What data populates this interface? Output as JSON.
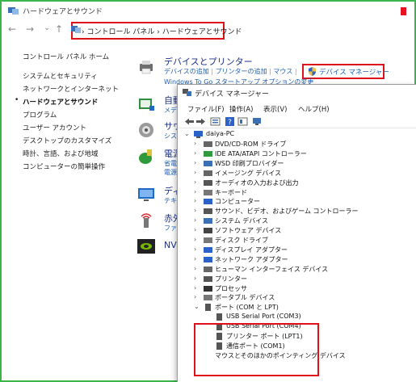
{
  "window": {
    "title": "ハードウェアとサウンド"
  },
  "breadcrumb": {
    "items": [
      "コントロール パネル",
      "ハードウェアとサウンド"
    ],
    "sep": "›"
  },
  "nav": {
    "back": "←",
    "forward": "→",
    "down": "⌄",
    "up": "↑"
  },
  "sidebar": {
    "home": "コントロール パネル ホーム",
    "items": [
      "システムとセキュリティ",
      "ネットワークとインターネット",
      "ハードウェアとサウンド",
      "プログラム",
      "ユーザー アカウント",
      "デスクトップのカスタマイズ",
      "時計、言語、および地域",
      "コンピューターの簡単操作"
    ],
    "bullet": "•"
  },
  "categories": {
    "devices": {
      "title": "デバイスとプリンター",
      "links": [
        "デバイスの追加",
        "プリンターの追加",
        "マウス",
        "デバイス マネージャー"
      ],
      "link2": "Windows To Go スタートアップ オプションの変更"
    },
    "autoplay": {
      "title": "自動",
      "link": "メディ"
    },
    "sound": {
      "title": "サウ",
      "link": "シス"
    },
    "power": {
      "title": "電源",
      "link": "省電",
      "link2": "電源"
    },
    "display": {
      "title": "ディス",
      "link": "テキ"
    },
    "infrared": {
      "title": "赤外",
      "link": "ファイ"
    },
    "nvidia": {
      "title": "NVI"
    }
  },
  "devmgr": {
    "title": "デバイス マネージャー",
    "menu": [
      "ファイル(F)",
      "操作(A)",
      "表示(V)",
      "ヘルプ(H)"
    ],
    "root": "daiya-PC",
    "nodes": [
      "DVD/CD-ROM ドライブ",
      "IDE ATA/ATAPI コントローラー",
      "WSD 印刷プロバイダー",
      "イメージング デバイス",
      "オーディオの入力および出力",
      "キーボード",
      "コンピューター",
      "サウンド、ビデオ、およびゲーム コントローラー",
      "システム デバイス",
      "ソフトウェア デバイス",
      "ディスク ドライブ",
      "ディスプレイ アダプター",
      "ネットワーク アダプター",
      "ヒューマン インターフェイス デバイス",
      "プリンター",
      "プロセッサ",
      "ポータブル デバイス"
    ],
    "ports_label": "ポート (COM と LPT)",
    "ports": [
      "USB Serial Port (COM3)",
      "USB Serial Port (COM4)",
      "プリンター ポート (LPT1)",
      "通信ポート (COM1)"
    ],
    "next_partial": "マウスとそのほかのポインティング デバイス",
    "expanded": "⌄",
    "collapsed": "›"
  },
  "colors": {
    "highlight": "#e0101a",
    "link": "#1e5fb4",
    "frame": "#39b54a"
  }
}
